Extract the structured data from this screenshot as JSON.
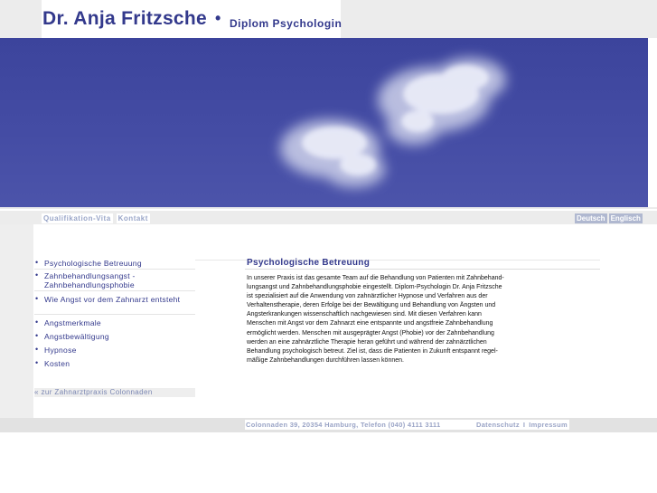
{
  "header": {
    "name": "Dr. Anja Fritzsche",
    "separator": "•",
    "subtitle": "Diplom Psychologin"
  },
  "top_nav": [
    "Qualifikation-Vita",
    "Kontakt"
  ],
  "language_nav": [
    "Deutsch",
    "Englisch"
  ],
  "side_nav": {
    "bullet": "•",
    "items": [
      "Psychologische Betreuung",
      "Zahnbehandlungsangst - Zahnbehandlungsphobie",
      "Wie Angst vor dem Zahnarzt entsteht",
      "Angstmerkmale",
      "Angstbewältigung",
      "Hypnose",
      "Kosten"
    ],
    "back_link": "«  zur Zahnarztpraxis Colonnaden"
  },
  "content": {
    "title": "Psychologische Betreuung",
    "text": "In unserer Praxis ist das gesamte Team auf die Behandlung von Patienten mit Zahnbehand-\nlungsangst und Zahnbehandlungsphobie eingestellt. Diplom-Psychologin Dr. Anja Fritzsche\nist spezialisiert auf die Anwendung von zahnärztlicher Hypnose und Verfahren aus der\nVerhaltenstherapie, deren Erfolge bei der Bewältigung und Behandlung von Ängsten und\nAngsterkrankungen wissenschaftlich nachgewiesen sind. Mit diesen Verfahren kann\nMenschen mit Angst vor dem Zahnarzt eine entspannte und angstfreie Zahnbehandlung\nermöglicht werden. Menschen mit ausgeprägter Angst (Phobie) vor der Zahnbehandlung\nwerden an eine zahnärztliche Therapie heran geführt und während der zahnärztlichen\nBehandlung psychologisch betreut. Ziel ist, dass die Patienten in Zukunft entspannt regel-\nmäßige Zahnbehandlungen durchführen lassen können."
  },
  "footer": {
    "address": "Colonnaden 39, 20354 Hamburg, Telefon (040) 4111 3111",
    "links": [
      "Datenschutz",
      "Impressum"
    ],
    "separator": "I"
  },
  "colors": {
    "brand_blue": "#33398c",
    "sky": "#444ca4",
    "nav_text": "#9aa6c8",
    "lang_bg": "#b0b8d0",
    "panel_gray": "#ececec"
  }
}
